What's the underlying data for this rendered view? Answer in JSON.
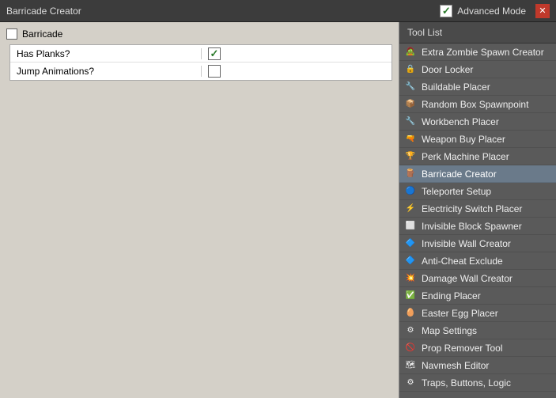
{
  "topBar": {
    "title": "Barricade Creator",
    "advancedMode": "Advanced Mode",
    "advancedChecked": true
  },
  "leftPanel": {
    "groupName": "Barricade",
    "properties": [
      {
        "label": "Has Planks?",
        "value": true
      },
      {
        "label": "Jump Animations?",
        "value": false
      }
    ]
  },
  "rightPanel": {
    "header": "Tool List",
    "tools": [
      {
        "id": "extra-zombie-spawn-creator",
        "label": "Extra Zombie Spawn Creator",
        "iconType": "zombie",
        "active": false
      },
      {
        "id": "door-locker",
        "label": "Door Locker",
        "iconType": "lock",
        "active": false
      },
      {
        "id": "buildable-placer",
        "label": "Buildable Placer",
        "iconType": "build",
        "active": false
      },
      {
        "id": "random-box-spawnpoint",
        "label": "Random Box Spawnpoint",
        "iconType": "box",
        "active": false
      },
      {
        "id": "workbench-placer",
        "label": "Workbench Placer",
        "iconType": "wrench",
        "active": false
      },
      {
        "id": "weapon-buy-placer",
        "label": "Weapon Buy Placer",
        "iconType": "weapon",
        "active": false
      },
      {
        "id": "perk-machine-placer",
        "label": "Perk Machine Placer",
        "iconType": "perk",
        "active": false
      },
      {
        "id": "barricade-creator",
        "label": "Barricade Creator",
        "iconType": "barricade",
        "active": true
      },
      {
        "id": "teleporter-setup",
        "label": "Teleporter Setup",
        "iconType": "teleport",
        "active": false
      },
      {
        "id": "electricity-switch-placer",
        "label": "Electricity Switch Placer",
        "iconType": "elec",
        "active": false
      },
      {
        "id": "invisible-block-spawner",
        "label": "Invisible Block Spawner",
        "iconType": "block",
        "active": false
      },
      {
        "id": "invisible-wall-creator",
        "label": "Invisible Wall Creator",
        "iconType": "wall",
        "active": false
      },
      {
        "id": "anti-cheat-exclude",
        "label": "Anti-Cheat Exclude",
        "iconType": "anticheat",
        "active": false
      },
      {
        "id": "damage-wall-creator",
        "label": "Damage Wall Creator",
        "iconType": "damage",
        "active": false
      },
      {
        "id": "ending-placer",
        "label": "Ending Placer",
        "iconType": "ending",
        "active": false
      },
      {
        "id": "easter-egg-placer",
        "label": "Easter Egg Placer",
        "iconType": "easter",
        "active": false
      },
      {
        "id": "map-settings",
        "label": "Map Settings",
        "iconType": "settings",
        "active": false
      },
      {
        "id": "prop-remover-tool",
        "label": "Prop Remover Tool",
        "iconType": "navmesh",
        "active": false
      },
      {
        "id": "navmesh-editor",
        "label": "Navmesh Editor",
        "iconType": "navmeshed",
        "active": false
      },
      {
        "id": "traps-buttons-logic",
        "label": "Traps, Buttons, Logic",
        "iconType": "traps",
        "active": false
      }
    ]
  }
}
